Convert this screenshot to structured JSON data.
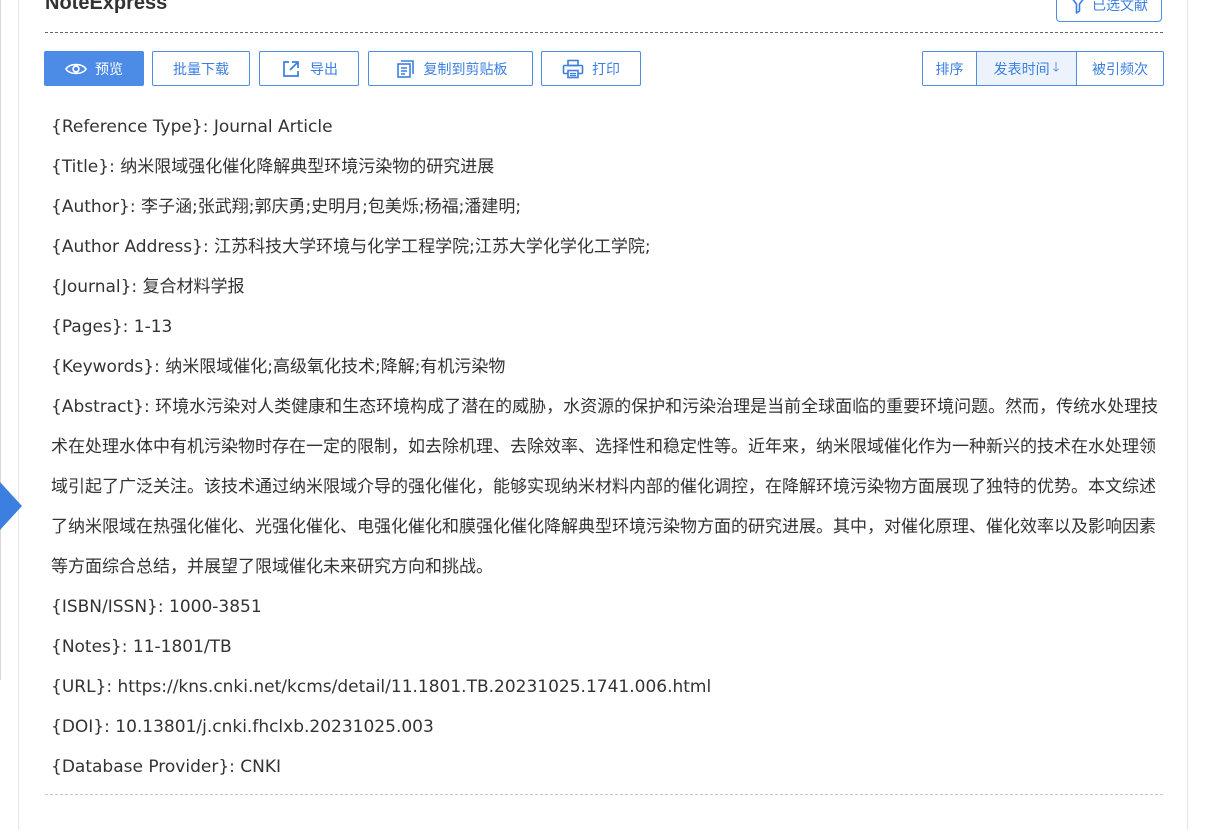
{
  "header": {
    "title": "NoteExpress",
    "selected_label": "已选文献"
  },
  "toolbar": {
    "preview_label": "预览",
    "batch_download_label": "批量下载",
    "export_label": "导出",
    "copy_label": "复制到剪贴板",
    "print_label": "打印"
  },
  "sort": {
    "label": "排序",
    "options": [
      "发表时间",
      "被引频次"
    ],
    "active_arrow": "🡓"
  },
  "record": [
    {
      "key": "{Reference Type}:",
      "value": "Journal Article"
    },
    {
      "key": "{Title}:",
      "value": "纳米限域强化催化降解典型环境污染物的研究进展"
    },
    {
      "key": "{Author}:",
      "value": "李子涵;张武翔;郭庆勇;史明月;包美烁;杨福;潘建明;"
    },
    {
      "key": "{Author Address}:",
      "value": "江苏科技大学环境与化学工程学院;江苏大学化学化工学院;"
    },
    {
      "key": "{Journal}:",
      "value": "复合材料学报"
    },
    {
      "key": "{Pages}:",
      "value": "1-13"
    },
    {
      "key": "{Keywords}:",
      "value": "纳米限域催化;高级氧化技术;降解;有机污染物"
    },
    {
      "key": "{Abstract}:",
      "value": "环境水污染对人类健康和生态环境构成了潜在的威胁，水资源的保护和污染治理是当前全球面临的重要环境问题。然而，传统水处理技术在处理水体中有机污染物时存在一定的限制，如去除机理、去除效率、选择性和稳定性等。近年来，纳米限域催化作为一种新兴的技术在水处理领域引起了广泛关注。该技术通过纳米限域介导的强化催化，能够实现纳米材料内部的催化调控，在降解环境污染物方面展现了独特的优势。本文综述了纳米限域在热强化催化、光强化催化、电强化催化和膜强化催化降解典型环境污染物方面的研究进展。其中，对催化原理、催化效率以及影响因素等方面综合总结，并展望了限域催化未来研究方向和挑战。"
    },
    {
      "key": "{ISBN/ISSN}:",
      "value": "1000-3851"
    },
    {
      "key": "{Notes}:",
      "value": "11-1801/TB"
    },
    {
      "key": "{URL}:",
      "value": "https://kns.cnki.net/kcms/detail/11.1801.TB.20231025.1741.006.html"
    },
    {
      "key": "{DOI}:",
      "value": "10.13801/j.cnki.fhclxb.20231025.003"
    },
    {
      "key": "{Database Provider}:",
      "value": "CNKI"
    }
  ],
  "colors": {
    "accent": "#3b7fe0",
    "primary_button": "#4c8be6"
  }
}
